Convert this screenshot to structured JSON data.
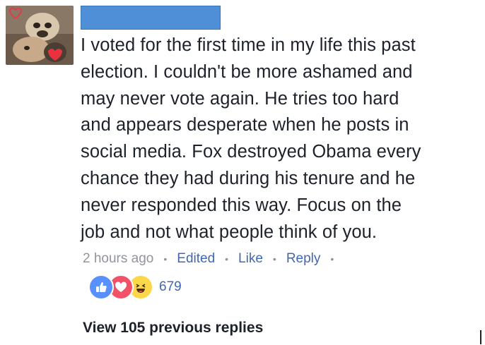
{
  "comment": {
    "lines": [
      "I voted for the first time in my life this past",
      "election. I couldn't be more ashamed and",
      "may never vote again. He tries too hard",
      "and appears desperate when he posts in",
      "social media. Fox destroyed Obama every",
      "chance they had during his tenure and he",
      "never responded this way. Focus on the",
      "job and not what people think of you."
    ]
  },
  "meta": {
    "time": "2 hours ago",
    "edited_label": "Edited",
    "like_label": "Like",
    "reply_label": "Reply",
    "separator": "•"
  },
  "reactions": {
    "icons": [
      "like-icon",
      "love-icon",
      "haha-icon"
    ],
    "count": "679",
    "colors": {
      "like": "#5890ff",
      "love": "#f25268",
      "haha": "#fcd748"
    }
  },
  "replies": {
    "view_label": "View 105 previous replies"
  },
  "colors": {
    "text": "#1d2129",
    "muted": "#90949c",
    "link": "#4267b2",
    "redaction": "#4f8fd8"
  }
}
